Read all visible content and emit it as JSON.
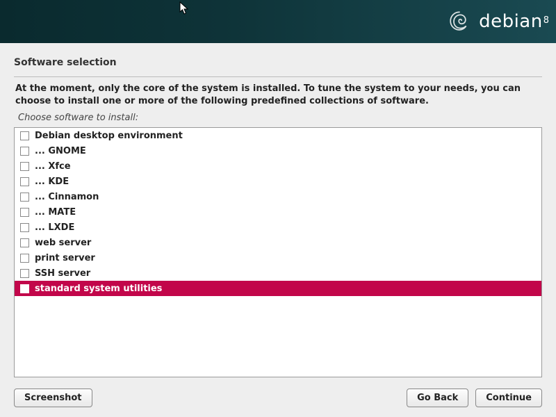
{
  "brand": {
    "name": "debian",
    "version": "8"
  },
  "page": {
    "title": "Software selection",
    "description": "At the moment, only the core of the system is installed. To tune the system to your needs, you can choose to install one or more of the following predefined collections of software.",
    "selector_label": "Choose software to install:"
  },
  "software": {
    "items": [
      {
        "label": "Debian desktop environment",
        "checked": false,
        "selected": false
      },
      {
        "label": "... GNOME",
        "checked": false,
        "selected": false
      },
      {
        "label": "... Xfce",
        "checked": false,
        "selected": false
      },
      {
        "label": "... KDE",
        "checked": false,
        "selected": false
      },
      {
        "label": "... Cinnamon",
        "checked": false,
        "selected": false
      },
      {
        "label": "... MATE",
        "checked": false,
        "selected": false
      },
      {
        "label": "... LXDE",
        "checked": false,
        "selected": false
      },
      {
        "label": "web server",
        "checked": false,
        "selected": false
      },
      {
        "label": "print server",
        "checked": false,
        "selected": false
      },
      {
        "label": "SSH server",
        "checked": false,
        "selected": false
      },
      {
        "label": "standard system utilities",
        "checked": false,
        "selected": true
      }
    ]
  },
  "buttons": {
    "screenshot": "Screenshot",
    "go_back": "Go Back",
    "continue": "Continue"
  },
  "colors": {
    "highlight": "#c2064a",
    "header_gradient_start": "#0a2a2e",
    "header_gradient_end": "#1a4a52"
  }
}
